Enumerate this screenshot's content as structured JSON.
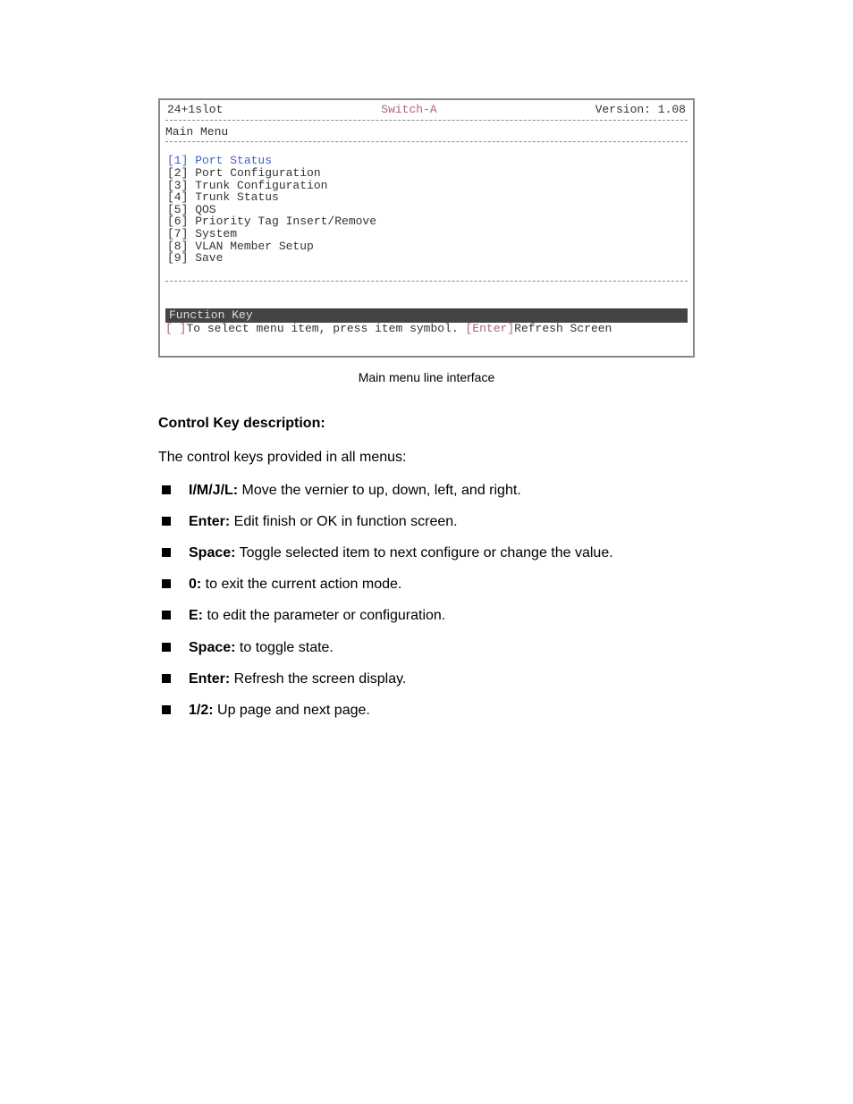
{
  "terminal": {
    "slot": "24+1slot",
    "device": "Switch-A",
    "version": "Version: 1.08",
    "section": "Main Menu",
    "items": [
      {
        "key": "[1]",
        "label": "Port Status",
        "highlight": true
      },
      {
        "key": "[2]",
        "label": "Port Configuration"
      },
      {
        "key": "[3]",
        "label": "Trunk Configuration"
      },
      {
        "key": "[4]",
        "label": "Trunk Status"
      },
      {
        "key": "[5]",
        "label": "QOS"
      },
      {
        "key": "[6]",
        "label": "Priority Tag Insert/Remove"
      },
      {
        "key": "[7]",
        "label": "System"
      },
      {
        "key": "[8]",
        "label": "VLAN Member Setup"
      },
      {
        "key": "[9]",
        "label": "Save"
      }
    ],
    "fn_title": "Function Key",
    "fn_bracket_open": "[",
    "fn_bracket_close": "]",
    "fn_text1": "To select menu item, press item symbol. ",
    "fn_enter_open": "[",
    "fn_enter_label": "Enter",
    "fn_enter_close": "]",
    "fn_text2": "Refresh Screen"
  },
  "caption": "Main menu line interface",
  "heading": "Control Key description:",
  "intro": "The control keys provided in all menus:",
  "keys": [
    {
      "k": "I/M/J/L:",
      "d": " Move the vernier to up, down, left, and right."
    },
    {
      "k": "Enter:",
      "d": " Edit finish or OK in function screen."
    },
    {
      "k": "Space:",
      "d": " Toggle selected item to next configure or change the value."
    },
    {
      "k": "0:",
      "d": " to exit the current action mode."
    },
    {
      "k": "E:",
      "d": " to edit the parameter or configuration."
    },
    {
      "k": "Space:",
      "d": " to toggle state."
    },
    {
      "k": "Enter:",
      "d": " Refresh the screen display."
    },
    {
      "k": "1/2:",
      "d": " Up page and next page."
    }
  ]
}
